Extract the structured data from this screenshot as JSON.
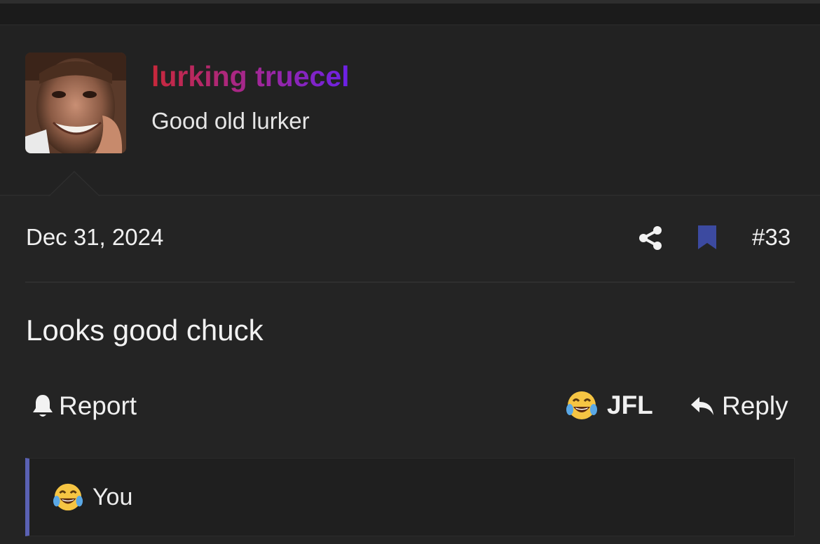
{
  "user": {
    "name": "lurking truecel",
    "title": "Good old lurker",
    "avatar": "avatar-photo"
  },
  "post": {
    "date": "Dec 31, 2024",
    "number": "#33",
    "body": "Looks good chuck"
  },
  "actions": {
    "report_label": "Report",
    "reaction_label": "JFL",
    "reply_label": "Reply"
  },
  "reactions": {
    "users": "You",
    "emoji": "laughing-tears-emoji"
  },
  "icons": {
    "share": "share-icon",
    "bookmark": "bookmark-icon",
    "bell": "bell-icon",
    "reply": "reply-arrow-icon"
  },
  "colors": {
    "background": "#242424",
    "username_gradient_start": "#c8283a",
    "username_gradient_mid": "#a0279a",
    "username_gradient_end": "#6b21e8",
    "bookmark": "#3c4aa0",
    "reaction_accent": "#5a61b3"
  }
}
